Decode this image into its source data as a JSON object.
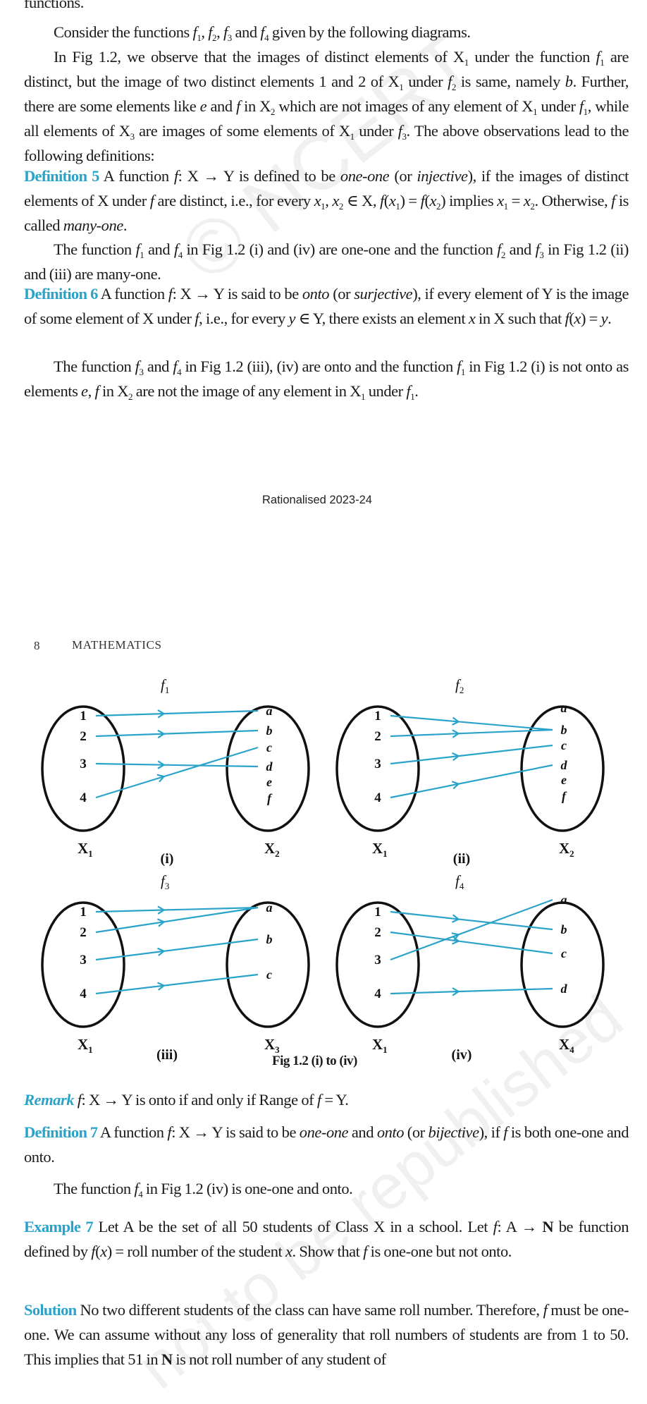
{
  "top_fragment": "functions.",
  "para_consider": {
    "text_a": "Consider the functions ",
    "f": "f",
    "subs": [
      "1",
      "2",
      "3",
      "4"
    ],
    "text_b": " given by the following diagrams."
  },
  "para_observe": {
    "s1": "In Fig 1.2, we observe that the images of distinct elements of X",
    "s1_sub": "1",
    "s2": " under the function ",
    "s3": " are distinct, but the image of two distinct elements 1 and 2 of X",
    "s4": " under ",
    "s5": " is same, namely ",
    "b": "b",
    "s6": ". Further, there are some elements like ",
    "e": "e",
    "s7": " and ",
    "ff": "f",
    "s8": " in X",
    "s9": " which are not images of any element of X",
    "s10": " under ",
    "s11": ", while all elements of X",
    "s12": " are images of some elements of X",
    "s13": " under ",
    "s14": ". The above observations lead to the following definitions:"
  },
  "def5": {
    "label": "Definition 5",
    "t1": " A function ",
    "t2": ": X → Y is defined to be ",
    "oneone": "one-one",
    "t3": " (or ",
    "injective": "injective",
    "t4": "), if the images of distinct elements of X under ",
    "t5": " are distinct, i.e., for every ",
    "t6": " ∈ X, ",
    "t7": " implies ",
    "t8": ". Otherwise, ",
    "t9": " is called ",
    "manyone": "many-one",
    "t10": "."
  },
  "para_f1f4": {
    "t1": "The function ",
    "t2": " and ",
    "t3": " in Fig 1.2 (i) and (iv) are one-one and the function ",
    "t4": " and ",
    "t5": " in Fig 1.2 (ii) and (iii) are many-one."
  },
  "def6": {
    "label": "Definition 6",
    "t1": " A function ",
    "t2": ": X → Y is said to be ",
    "onto": "onto",
    "t3": " (or ",
    "surjective": "surjective",
    "t4": "), if every element of Y is the image of some element of X under ",
    "t5": ", i.e., for every ",
    "t6": " ∈ Y, there exists an element ",
    "t7": " in X such that ",
    "t8": "."
  },
  "para_f3f4": {
    "t1": "The function ",
    "t2": " and ",
    "t3": " in Fig 1.2 (iii), (iv) are onto and the function ",
    "t4": " in Fig 1.2 (i) is not onto as elements ",
    "t5": " in X",
    "t6": " are not the image of any element in X",
    "t7": " under "
  },
  "footer_stamp": "Rationalised 2023-24",
  "page_header": {
    "number": "8",
    "title": "MATHEMATICS"
  },
  "figure": {
    "caption": "Fig 1.2 (i) to (iv)",
    "arrow_color": "#2aa3c9",
    "diagrams": [
      {
        "id": "i",
        "label": "(i)",
        "function": "f",
        "function_sub": "1",
        "domain_label": "X",
        "domain_sub": "1",
        "codomain_label": "X",
        "codomain_sub": "2",
        "domain": [
          "1",
          "2",
          "3",
          "4"
        ],
        "codomain": [
          "a",
          "b",
          "c",
          "d",
          "e",
          "f"
        ],
        "mapping": [
          [
            "1",
            "a"
          ],
          [
            "2",
            "b"
          ],
          [
            "3",
            "d"
          ],
          [
            "4",
            "c"
          ]
        ]
      },
      {
        "id": "ii",
        "label": "(ii)",
        "function": "f",
        "function_sub": "2",
        "domain_label": "X",
        "domain_sub": "1",
        "codomain_label": "X",
        "codomain_sub": "2",
        "domain": [
          "1",
          "2",
          "3",
          "4"
        ],
        "codomain": [
          "a",
          "b",
          "c",
          "d",
          "e",
          "f"
        ],
        "mapping": [
          [
            "1",
            "b"
          ],
          [
            "2",
            "b"
          ],
          [
            "3",
            "c"
          ],
          [
            "4",
            "d"
          ]
        ]
      },
      {
        "id": "iii",
        "label": "(iii)",
        "function": "f",
        "function_sub": "3",
        "domain_label": "X",
        "domain_sub": "1",
        "codomain_label": "X",
        "codomain_sub": "3",
        "domain": [
          "1",
          "2",
          "3",
          "4"
        ],
        "codomain": [
          "a",
          "b",
          "c"
        ],
        "mapping": [
          [
            "1",
            "a"
          ],
          [
            "2",
            "a"
          ],
          [
            "3",
            "b"
          ],
          [
            "4",
            "c"
          ]
        ]
      },
      {
        "id": "iv",
        "label": "(iv)",
        "function": "f",
        "function_sub": "4",
        "domain_label": "X",
        "domain_sub": "1",
        "codomain_label": "X",
        "codomain_sub": "4",
        "domain": [
          "1",
          "2",
          "3",
          "4"
        ],
        "codomain": [
          "a",
          "b",
          "c",
          "d"
        ],
        "mapping": [
          [
            "1",
            "b"
          ],
          [
            "2",
            "c"
          ],
          [
            "3",
            "a"
          ],
          [
            "4",
            "d"
          ]
        ]
      }
    ]
  },
  "remark": {
    "label": "Remark",
    "t1": " f",
    "t2": ": X → Y is onto if and only if Range of ",
    "t3": "f",
    "t4": " = Y."
  },
  "def7": {
    "label": "Definition 7",
    "t1": " A function ",
    "t2": ": X → Y is said to be ",
    "oneone": "one-one",
    "t3": " and ",
    "onto": "onto",
    "t4": " (or ",
    "bijective": "bijective",
    "t5": "), if ",
    "t6": " is both one-one and onto."
  },
  "para_f4": {
    "t1": "The function ",
    "t2": " in Fig 1.2 (iv) is one-one and onto."
  },
  "example7": {
    "label": "Example 7",
    "t1": " Let A be the set of all 50 students of Class X in a school. Let ",
    "t2": ": A → ",
    "N": "N",
    "t3": " be function defined by ",
    "t4": "(",
    "x": "x",
    "t5": ") = roll number of the student ",
    "t6": ". Show that ",
    "t7": " is one-one but not onto."
  },
  "solution": {
    "label": "Solution",
    "t1": " No two different students of the class can have same roll number. Therefore, ",
    "t2": " must be one-one. We can assume without any loss of generality that roll numbers of students are from 1 to 50. This implies that 51 in ",
    "N": "N",
    "t3": " is not roll number of any student of"
  },
  "watermarks": [
    "© NCERT",
    "not to be republished"
  ]
}
